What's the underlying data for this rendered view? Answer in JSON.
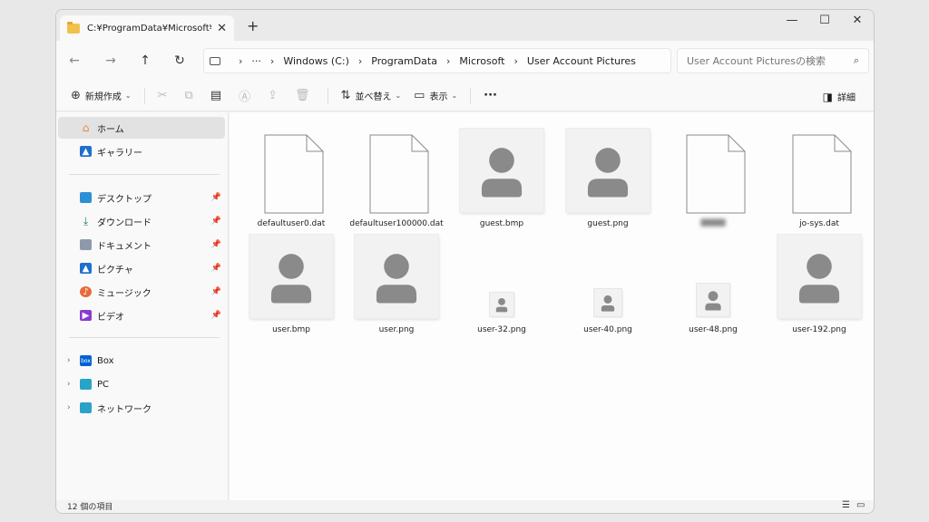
{
  "window": {
    "tab_title": "C:¥ProgramData¥Microsoft¥U",
    "tab_close": "✕",
    "new_tab": "+",
    "minimize": "—",
    "maximize": "☐",
    "close": "✕"
  },
  "address": {
    "back": "←",
    "forward": "→",
    "up": "↑",
    "refresh": "↻",
    "overflow": "···",
    "breadcrumbs": [
      "Windows (C:)",
      "ProgramData",
      "Microsoft",
      "User Account Pictures"
    ],
    "search_placeholder": "User Account Picturesの検索"
  },
  "commands": {
    "new_label": "新規作成",
    "sort_label": "並べ替え",
    "view_label": "表示",
    "more": "···",
    "details_label": "詳細"
  },
  "sidebar": {
    "home": "ホーム",
    "gallery": "ギャラリー",
    "desktop": "デスクトップ",
    "downloads": "ダウンロード",
    "documents": "ドキュメント",
    "pictures": "ピクチャ",
    "music": "ミュージック",
    "videos": "ビデオ",
    "box": "Box",
    "pc": "PC",
    "network": "ネットワーク"
  },
  "files": [
    {
      "name": "defaultuser0.dat",
      "kind": "document"
    },
    {
      "name": "defaultuser100000.dat",
      "kind": "document"
    },
    {
      "name": "guest.bmp",
      "kind": "image"
    },
    {
      "name": "guest.png",
      "kind": "image"
    },
    {
      "name": "blurred-name",
      "kind": "document",
      "blurred": true
    },
    {
      "name": "jo-sys.dat",
      "kind": "document"
    },
    {
      "name": "user.bmp",
      "kind": "image"
    },
    {
      "name": "user.png",
      "kind": "image"
    },
    {
      "name": "user-32.png",
      "kind": "image-small"
    },
    {
      "name": "user-40.png",
      "kind": "image-small"
    },
    {
      "name": "user-48.png",
      "kind": "image-small"
    },
    {
      "name": "user-192.png",
      "kind": "image"
    }
  ],
  "status": {
    "item_count": "12 個の項目"
  },
  "colors": {
    "accent": "#0067c0",
    "folder": "#f2c14b",
    "avatar": "#8a8a8a"
  }
}
